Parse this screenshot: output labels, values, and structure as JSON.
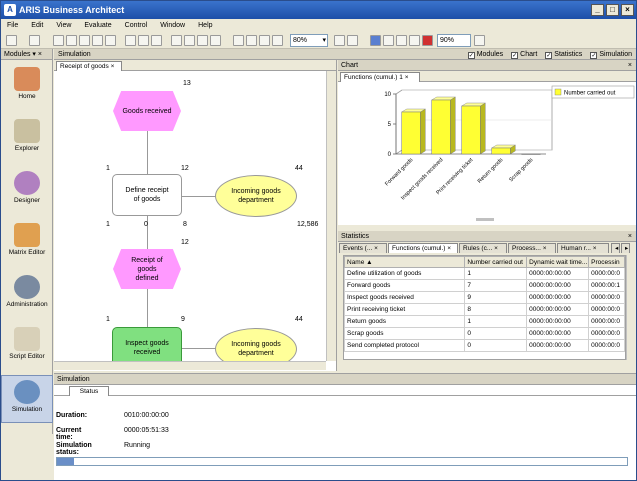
{
  "window": {
    "title": "ARIS Business Architect"
  },
  "menu": [
    "File",
    "Edit",
    "View",
    "Evaluate",
    "Control",
    "Window",
    "Help"
  ],
  "toolbar": {
    "zoom1": "80%",
    "zoom2": "90%"
  },
  "modules": {
    "header": "Modules",
    "items": [
      {
        "label": "Home",
        "icon": "home-icon",
        "color": "#d98b5a"
      },
      {
        "label": "Explorer",
        "icon": "book-icon",
        "color": "#c9c0a0"
      },
      {
        "label": "Designer",
        "icon": "designer-icon",
        "color": "#b080c0"
      },
      {
        "label": "Matrix Editor",
        "icon": "matrix-icon",
        "color": "#e0a050"
      },
      {
        "label": "Administration",
        "icon": "gears-icon",
        "color": "#7a8aa0"
      },
      {
        "label": "Script Editor",
        "icon": "scroll-icon",
        "color": "#d8d0b8"
      },
      {
        "label": "Simulation",
        "icon": "clock-icon",
        "color": "#6a90c0"
      }
    ]
  },
  "simulation": {
    "header": "Simulation",
    "options": [
      "Modules",
      "Chart",
      "Statistics",
      "Simulation"
    ]
  },
  "model": {
    "tab": "Receipt of goods",
    "nodes": {
      "e1": "Goods received",
      "f1": "Define receipt of goods",
      "o1": "Incoming goods department",
      "e2": "Receipt of goods defined",
      "f2": "Inspect goods received",
      "o2": "Incoming goods department"
    },
    "numbers": {
      "n13": "13",
      "n1a": "1",
      "n12a": "12",
      "n44a": "44",
      "n1b": "1",
      "n0": "0",
      "n8": "8",
      "n12586": "12,586",
      "n12b": "12",
      "n1c": "1",
      "n9": "9",
      "n44b": "44"
    }
  },
  "chart": {
    "header": "Chart",
    "tab": "Functions (cumul.) 1"
  },
  "chart_data": {
    "type": "bar",
    "categories": [
      "Forward goods",
      "Inspect goods received",
      "Print receiving ticket",
      "Return goods",
      "Scrap goods"
    ],
    "series": [
      {
        "name": "Number carried out",
        "values": [
          7,
          9,
          8,
          1,
          0
        ]
      }
    ],
    "ylim": [
      0,
      10
    ],
    "yticks": [
      "0",
      "5",
      "10"
    ],
    "legend": "top-right",
    "bar_color": "#ffff33"
  },
  "statistics": {
    "header": "Statistics",
    "tabs": [
      "Events (...",
      "Functions (cumul.)",
      "Rules (c...",
      "Process...",
      "Human r..."
    ],
    "columns": [
      "Name",
      "Number carried out",
      "Dynamic wait time...",
      "Processin"
    ],
    "rows": [
      [
        "Define utilization of goods",
        "1",
        "0000:00:00:00",
        "0000:00:0"
      ],
      [
        "Forward goods",
        "7",
        "0000:00:00:00",
        "0000:00:1"
      ],
      [
        "Inspect goods received",
        "9",
        "0000:00:00:00",
        "0000:00:0"
      ],
      [
        "Print receiving ticket",
        "8",
        "0000:00:00:00",
        "0000:00:0"
      ],
      [
        "Return goods",
        "1",
        "0000:00:00:00",
        "0000:00:0"
      ],
      [
        "Scrap goods",
        "0",
        "0000:00:00:00",
        "0000:00:0"
      ],
      [
        "Send completed protocol",
        "0",
        "0000:00:00:00",
        "0000:00:0"
      ]
    ]
  },
  "status_panel": {
    "header": "Simulation",
    "tab": "Status",
    "duration_label": "Duration:",
    "duration": "0010:00:00:00",
    "current_label": "Current time:",
    "current": "0000:05:51:33",
    "status_label": "Simulation status:",
    "status": "Running",
    "progress": 0.03
  }
}
